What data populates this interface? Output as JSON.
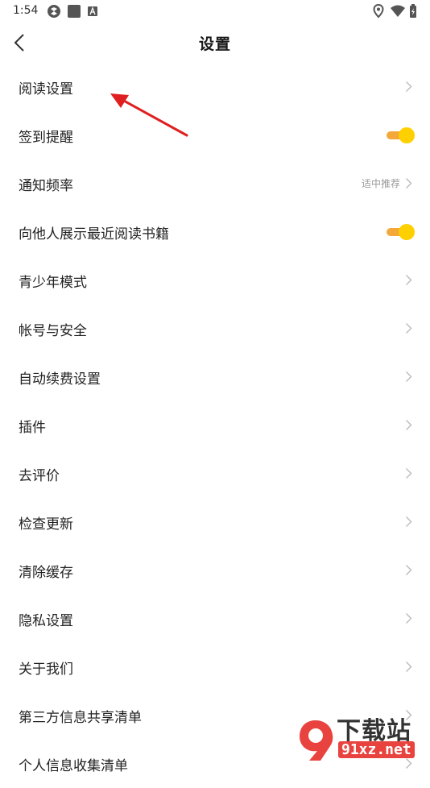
{
  "status_bar": {
    "time": "1:54"
  },
  "header": {
    "title": "设置"
  },
  "settings": [
    {
      "label": "阅读设置",
      "control": "chevron"
    },
    {
      "label": "签到提醒",
      "control": "toggle",
      "on": true
    },
    {
      "label": "通知频率",
      "control": "chevron",
      "value": "适中推荐"
    },
    {
      "label": "向他人展示最近阅读书籍",
      "control": "toggle",
      "on": true
    },
    {
      "label": "青少年模式",
      "control": "chevron"
    },
    {
      "label": "帐号与安全",
      "control": "chevron"
    },
    {
      "label": "自动续费设置",
      "control": "chevron"
    },
    {
      "label": "插件",
      "control": "chevron"
    },
    {
      "label": "去评价",
      "control": "chevron"
    },
    {
      "label": "检查更新",
      "control": "chevron"
    },
    {
      "label": "清除缓存",
      "control": "chevron"
    },
    {
      "label": "隐私设置",
      "control": "chevron"
    },
    {
      "label": "关于我们",
      "control": "chevron"
    },
    {
      "label": "第三方信息共享清单",
      "control": "chevron"
    },
    {
      "label": "个人信息收集清单",
      "control": "chevron"
    }
  ],
  "colors": {
    "toggle_track": "#f4a83a",
    "toggle_knob": "#ffd000",
    "annotation_arrow": "#e02020"
  },
  "watermark": {
    "title": "下载站",
    "url": "91xz.net"
  }
}
